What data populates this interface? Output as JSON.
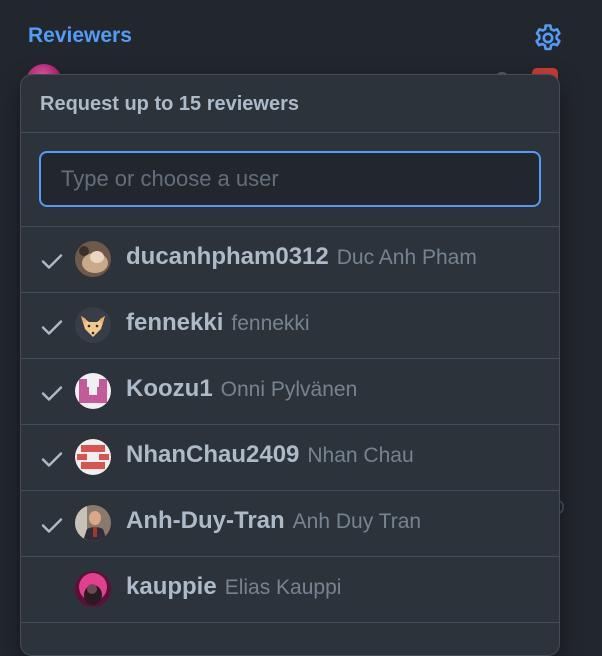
{
  "sidebar": {
    "title": "Reviewers",
    "settings_icon": "gear-icon",
    "accent_color": "#539bf5"
  },
  "popover": {
    "title": "Request up to 15 reviewers",
    "filter": {
      "placeholder": "Type or choose a user",
      "value": ""
    },
    "users": [
      {
        "login": "ducanhpham0312",
        "name": "Duc Anh Pham",
        "selected": true,
        "avatar": "cat-photo-avatar"
      },
      {
        "login": "fennekki",
        "name": "fennekki",
        "selected": true,
        "avatar": "fox-avatar"
      },
      {
        "login": "Koozu1",
        "name": "Onni Pylvänen",
        "selected": true,
        "avatar": "pink-identicon-avatar"
      },
      {
        "login": "NhanChau2409",
        "name": "Nhan Chau",
        "selected": true,
        "avatar": "red-identicon-avatar"
      },
      {
        "login": "Anh-Duy-Tran",
        "name": "Anh Duy Tran",
        "selected": true,
        "avatar": "person-photo-avatar"
      },
      {
        "login": "kauppie",
        "name": "Elias Kauppi",
        "selected": false,
        "avatar": "pink-photo-avatar"
      }
    ]
  }
}
